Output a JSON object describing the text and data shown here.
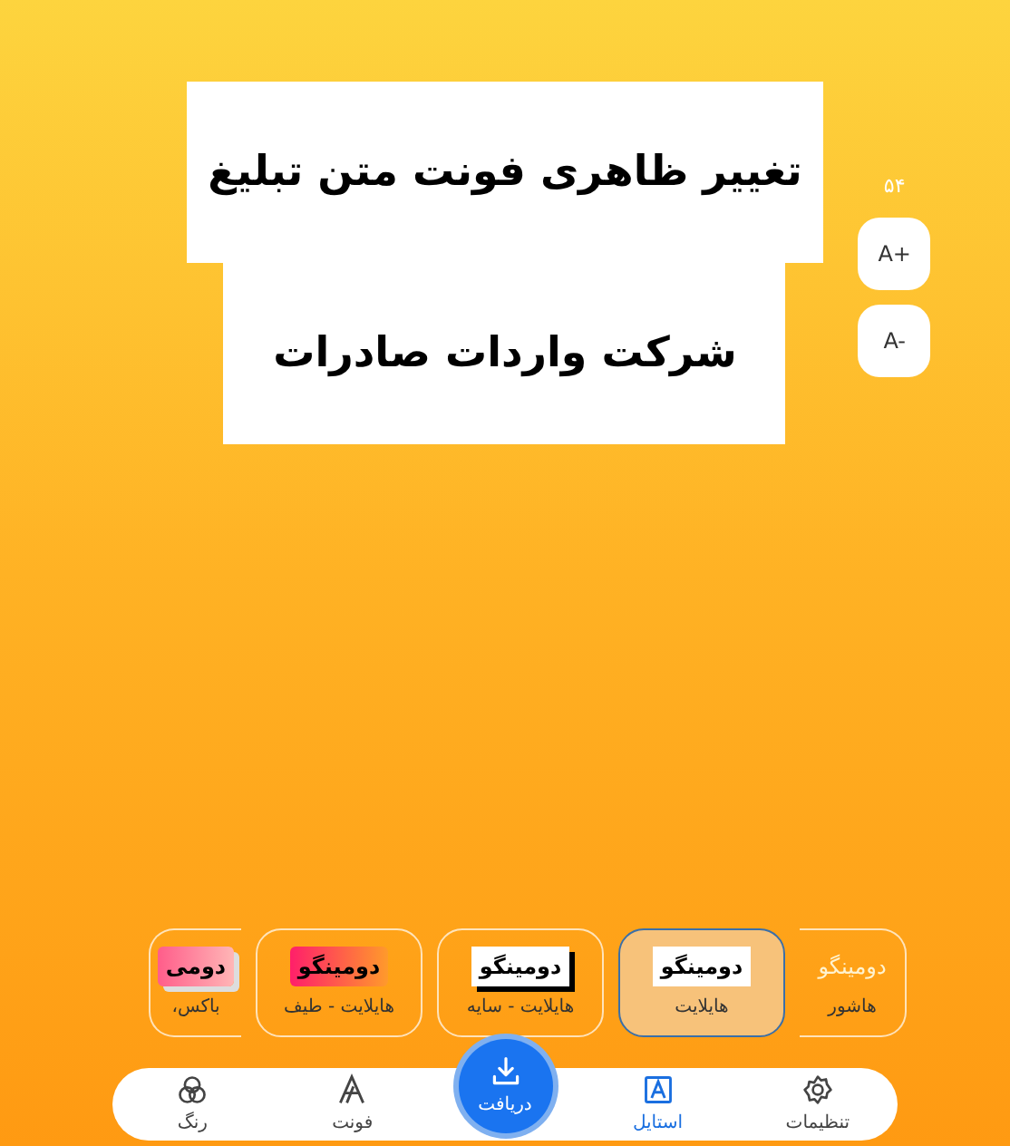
{
  "headline": {
    "lines": [
      "تغییر ظاهری فونت متن تبلیغ",
      "شرکت واردات صادرات"
    ]
  },
  "size": {
    "value": "۵۴",
    "increase": "A+",
    "decrease": "A-"
  },
  "styles": [
    {
      "kind": "hatch",
      "preview": "دومینگو",
      "label": "هاشور",
      "selected": false
    },
    {
      "kind": "highlight",
      "preview": "دومینگو",
      "label": "هایلایت",
      "selected": true
    },
    {
      "kind": "shadow",
      "preview": "دومینگو",
      "label": "هایلایت - سایه",
      "selected": false
    },
    {
      "kind": "gradient",
      "preview": "دومینگو",
      "label": "هایلایت - طیف",
      "selected": false
    },
    {
      "kind": "box",
      "preview": "دومی",
      "label": "باکس،",
      "selected": false
    }
  ],
  "nav": [
    {
      "kind": "settings",
      "label": "تنظیمات",
      "selected": false
    },
    {
      "kind": "style",
      "label": "استایل",
      "selected": true
    },
    {
      "kind": "download",
      "label": "دریافت",
      "selected": false
    },
    {
      "kind": "font",
      "label": "فونت",
      "selected": false
    },
    {
      "kind": "color",
      "label": "رنگ",
      "selected": false
    }
  ]
}
